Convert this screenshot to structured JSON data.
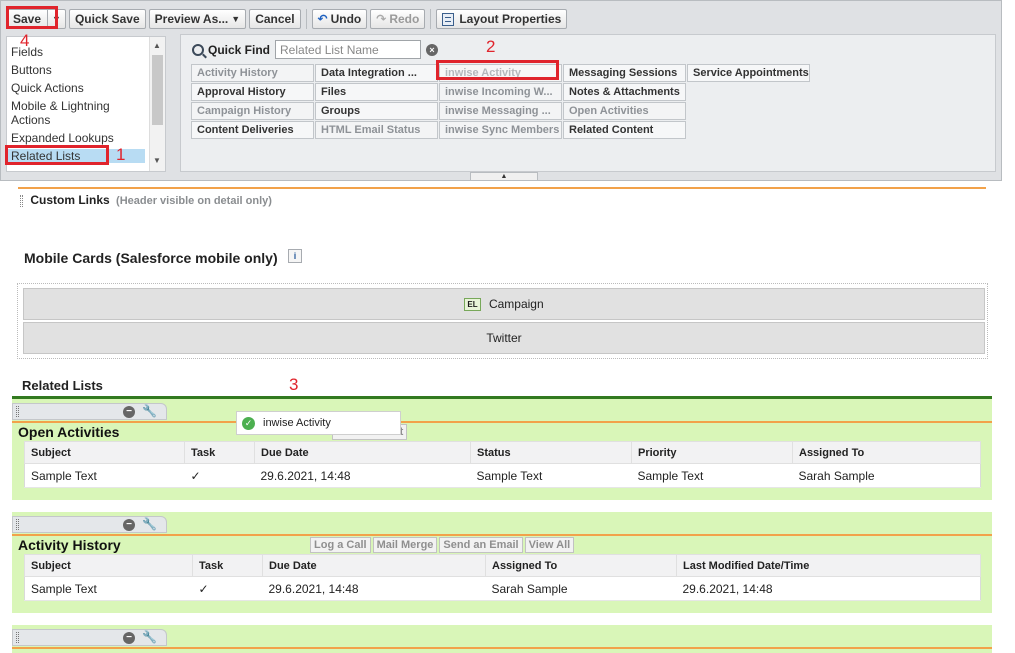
{
  "toolbar": {
    "save": "Save",
    "save_menu": "▼",
    "quick_save": "Quick Save",
    "preview_as": "Preview As...",
    "cancel": "Cancel",
    "undo": "Undo",
    "redo": "Redo",
    "layout_properties": "Layout Properties"
  },
  "categories": [
    "Fields",
    "Buttons",
    "Quick Actions",
    "Mobile & Lightning Actions",
    "Expanded Lookups",
    "Related Lists"
  ],
  "quick_find": {
    "label": "Quick Find",
    "placeholder": "Related List Name"
  },
  "palette_items": [
    [
      "Activity History",
      "Approval History",
      "Campaign History",
      "Content Deliveries"
    ],
    [
      "Data Integration ...",
      "Files",
      "Groups",
      "HTML Email Status"
    ],
    [
      "inwise Activity",
      "inwise Incoming W...",
      "inwise Messaging ...",
      "inwise Sync Members"
    ],
    [
      "Messaging Sessions",
      "Notes & Attachments",
      "Open Activities",
      "Related Content"
    ],
    [
      "Service Appointments"
    ]
  ],
  "annotations": [
    "1",
    "2",
    "3",
    "4"
  ],
  "custom_links": {
    "title": "Custom Links",
    "subtitle": "(Header visible on detail only)"
  },
  "mobile_cards": {
    "title": "Mobile Cards (Salesforce mobile only)",
    "info": "i",
    "badge": "EL",
    "cards": [
      "Campaign",
      "Twitter"
    ]
  },
  "related_lists": {
    "title": "Related Lists",
    "drag_ghost": "inwise Activity",
    "open_activities": {
      "title": "Open Activities",
      "buttons": [
        "Create Event"
      ],
      "columns": [
        "Subject",
        "Task",
        "Due Date",
        "Status",
        "Priority",
        "Assigned To"
      ],
      "row": [
        "Sample Text",
        "✓",
        "29.6.2021, 14:48",
        "Sample Text",
        "Sample Text",
        "Sarah Sample"
      ]
    },
    "activity_history": {
      "title": "Activity History",
      "buttons": [
        "Log a Call",
        "Mail Merge",
        "Send an Email",
        "View All"
      ],
      "columns": [
        "Subject",
        "Task",
        "Due Date",
        "Assigned To",
        "Last Modified Date/Time"
      ],
      "row": [
        "Sample Text",
        "✓",
        "29.6.2021, 14:48",
        "Sarah Sample",
        "29.6.2021, 14:48"
      ]
    }
  }
}
